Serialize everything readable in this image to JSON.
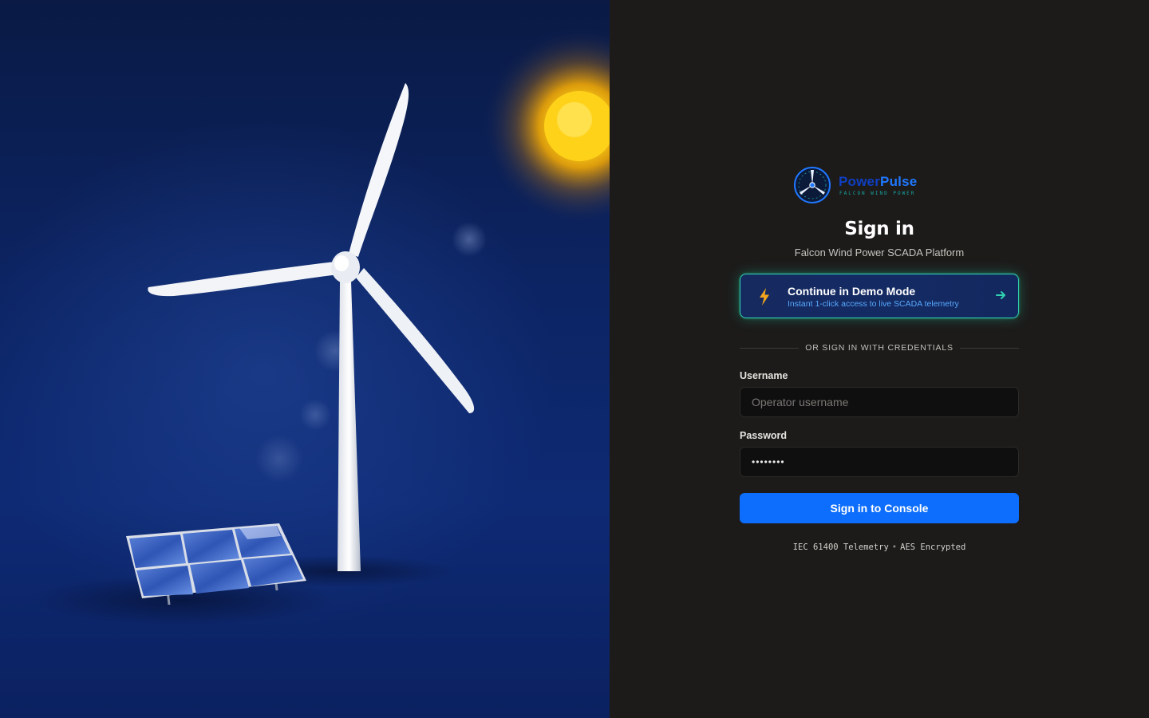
{
  "hero": {
    "illustration": "wind-turbine-and-solar-panel-at-night-with-sun"
  },
  "brand": {
    "name_part1": "Power",
    "name_part2": "Pulse",
    "tagline": "FALCON WIND POWER",
    "logo_icon": "turbine-compass-icon",
    "colors": {
      "primary": "#1f78ff",
      "dark": "#0f3fc2",
      "accent": "#1aa6a0"
    }
  },
  "login": {
    "title": "Sign in",
    "subtitle": "Falcon Wind Power SCADA Platform",
    "demo": {
      "title": "Continue in Demo Mode",
      "subtitle": "Instant 1-click access to live SCADA telemetry",
      "icon": "lightning-bolt-icon",
      "arrow_icon": "arrow-right-icon",
      "border_color": "#2fd3b0"
    },
    "divider_text": "OR SIGN IN WITH CREDENTIALS",
    "username": {
      "label": "Username",
      "placeholder": "Operator username",
      "value": ""
    },
    "password": {
      "label": "Password",
      "placeholder": "",
      "value": "••••••••"
    },
    "submit_label": "Sign in to Console",
    "submit_color": "#0d6efd",
    "footer": {
      "left": "IEC 61400 Telemetry",
      "separator": "•",
      "right": "AES Encrypted"
    }
  }
}
